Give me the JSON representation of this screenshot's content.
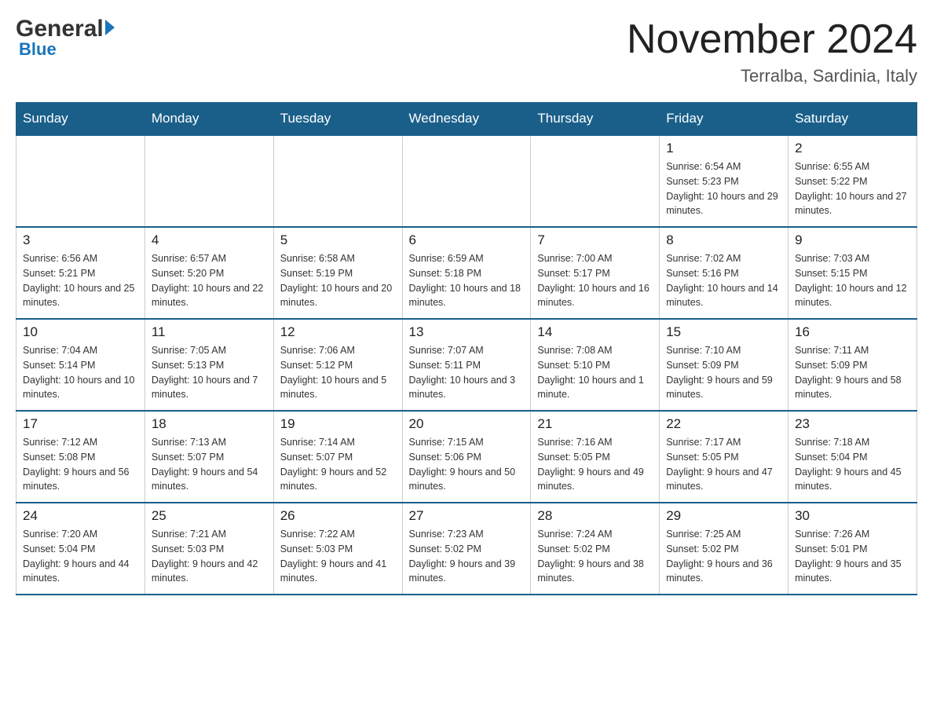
{
  "header": {
    "logo_main": "General",
    "logo_sub": "Blue",
    "month_title": "November 2024",
    "location": "Terralba, Sardinia, Italy"
  },
  "days_of_week": [
    "Sunday",
    "Monday",
    "Tuesday",
    "Wednesday",
    "Thursday",
    "Friday",
    "Saturday"
  ],
  "weeks": [
    [
      {
        "day": "",
        "info": ""
      },
      {
        "day": "",
        "info": ""
      },
      {
        "day": "",
        "info": ""
      },
      {
        "day": "",
        "info": ""
      },
      {
        "day": "",
        "info": ""
      },
      {
        "day": "1",
        "info": "Sunrise: 6:54 AM\nSunset: 5:23 PM\nDaylight: 10 hours and 29 minutes."
      },
      {
        "day": "2",
        "info": "Sunrise: 6:55 AM\nSunset: 5:22 PM\nDaylight: 10 hours and 27 minutes."
      }
    ],
    [
      {
        "day": "3",
        "info": "Sunrise: 6:56 AM\nSunset: 5:21 PM\nDaylight: 10 hours and 25 minutes."
      },
      {
        "day": "4",
        "info": "Sunrise: 6:57 AM\nSunset: 5:20 PM\nDaylight: 10 hours and 22 minutes."
      },
      {
        "day": "5",
        "info": "Sunrise: 6:58 AM\nSunset: 5:19 PM\nDaylight: 10 hours and 20 minutes."
      },
      {
        "day": "6",
        "info": "Sunrise: 6:59 AM\nSunset: 5:18 PM\nDaylight: 10 hours and 18 minutes."
      },
      {
        "day": "7",
        "info": "Sunrise: 7:00 AM\nSunset: 5:17 PM\nDaylight: 10 hours and 16 minutes."
      },
      {
        "day": "8",
        "info": "Sunrise: 7:02 AM\nSunset: 5:16 PM\nDaylight: 10 hours and 14 minutes."
      },
      {
        "day": "9",
        "info": "Sunrise: 7:03 AM\nSunset: 5:15 PM\nDaylight: 10 hours and 12 minutes."
      }
    ],
    [
      {
        "day": "10",
        "info": "Sunrise: 7:04 AM\nSunset: 5:14 PM\nDaylight: 10 hours and 10 minutes."
      },
      {
        "day": "11",
        "info": "Sunrise: 7:05 AM\nSunset: 5:13 PM\nDaylight: 10 hours and 7 minutes."
      },
      {
        "day": "12",
        "info": "Sunrise: 7:06 AM\nSunset: 5:12 PM\nDaylight: 10 hours and 5 minutes."
      },
      {
        "day": "13",
        "info": "Sunrise: 7:07 AM\nSunset: 5:11 PM\nDaylight: 10 hours and 3 minutes."
      },
      {
        "day": "14",
        "info": "Sunrise: 7:08 AM\nSunset: 5:10 PM\nDaylight: 10 hours and 1 minute."
      },
      {
        "day": "15",
        "info": "Sunrise: 7:10 AM\nSunset: 5:09 PM\nDaylight: 9 hours and 59 minutes."
      },
      {
        "day": "16",
        "info": "Sunrise: 7:11 AM\nSunset: 5:09 PM\nDaylight: 9 hours and 58 minutes."
      }
    ],
    [
      {
        "day": "17",
        "info": "Sunrise: 7:12 AM\nSunset: 5:08 PM\nDaylight: 9 hours and 56 minutes."
      },
      {
        "day": "18",
        "info": "Sunrise: 7:13 AM\nSunset: 5:07 PM\nDaylight: 9 hours and 54 minutes."
      },
      {
        "day": "19",
        "info": "Sunrise: 7:14 AM\nSunset: 5:07 PM\nDaylight: 9 hours and 52 minutes."
      },
      {
        "day": "20",
        "info": "Sunrise: 7:15 AM\nSunset: 5:06 PM\nDaylight: 9 hours and 50 minutes."
      },
      {
        "day": "21",
        "info": "Sunrise: 7:16 AM\nSunset: 5:05 PM\nDaylight: 9 hours and 49 minutes."
      },
      {
        "day": "22",
        "info": "Sunrise: 7:17 AM\nSunset: 5:05 PM\nDaylight: 9 hours and 47 minutes."
      },
      {
        "day": "23",
        "info": "Sunrise: 7:18 AM\nSunset: 5:04 PM\nDaylight: 9 hours and 45 minutes."
      }
    ],
    [
      {
        "day": "24",
        "info": "Sunrise: 7:20 AM\nSunset: 5:04 PM\nDaylight: 9 hours and 44 minutes."
      },
      {
        "day": "25",
        "info": "Sunrise: 7:21 AM\nSunset: 5:03 PM\nDaylight: 9 hours and 42 minutes."
      },
      {
        "day": "26",
        "info": "Sunrise: 7:22 AM\nSunset: 5:03 PM\nDaylight: 9 hours and 41 minutes."
      },
      {
        "day": "27",
        "info": "Sunrise: 7:23 AM\nSunset: 5:02 PM\nDaylight: 9 hours and 39 minutes."
      },
      {
        "day": "28",
        "info": "Sunrise: 7:24 AM\nSunset: 5:02 PM\nDaylight: 9 hours and 38 minutes."
      },
      {
        "day": "29",
        "info": "Sunrise: 7:25 AM\nSunset: 5:02 PM\nDaylight: 9 hours and 36 minutes."
      },
      {
        "day": "30",
        "info": "Sunrise: 7:26 AM\nSunset: 5:01 PM\nDaylight: 9 hours and 35 minutes."
      }
    ]
  ]
}
